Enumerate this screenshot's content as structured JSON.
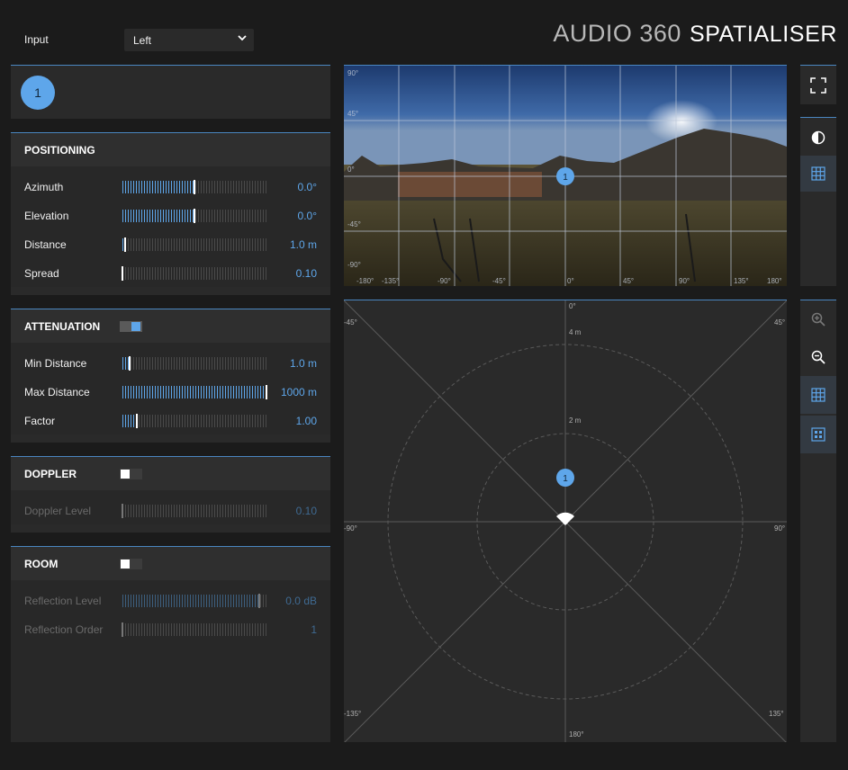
{
  "header": {
    "input_label": "Input",
    "input_value": "Left",
    "logo_audio": "AUDIO 360",
    "logo_spatialiser": "SPATIALISER"
  },
  "source_panel": {
    "selected_source": "1"
  },
  "positioning": {
    "title": "POSITIONING",
    "rows": [
      {
        "label": "Azimuth",
        "value": "0.0°",
        "level": 0.5
      },
      {
        "label": "Elevation",
        "value": "0.0°",
        "level": 0.5
      },
      {
        "label": "Distance",
        "value": "1.0 m",
        "level": 0.02
      },
      {
        "label": "Spread",
        "value": "0.10",
        "level": 0.0
      }
    ]
  },
  "attenuation": {
    "title": "ATTENUATION",
    "enabled": true,
    "rows": [
      {
        "label": "Min Distance",
        "value": "1.0 m",
        "level": 0.05
      },
      {
        "label": "Max Distance",
        "value": "1000 m",
        "level": 1.0
      },
      {
        "label": "Factor",
        "value": "1.00",
        "level": 0.1
      }
    ]
  },
  "doppler": {
    "title": "DOPPLER",
    "enabled": false,
    "rows": [
      {
        "label": "Doppler Level",
        "value": "0.10",
        "level": 0.0
      }
    ]
  },
  "room": {
    "title": "ROOM",
    "enabled": false,
    "rows": [
      {
        "label": "Reflection Level",
        "value": "0.0 dB",
        "level": 0.95
      },
      {
        "label": "Reflection Order",
        "value": "1",
        "level": 0.0
      }
    ]
  },
  "panorama": {
    "elevation_labels": [
      "90°",
      "45°",
      "0°",
      "-45°",
      "-90°"
    ],
    "azimuth_labels": [
      "-180°",
      "-135°",
      "-90°",
      "-45°",
      "0°",
      "45°",
      "90°",
      "135°",
      "180°"
    ],
    "source_label": "1"
  },
  "top_down": {
    "angle_labels": {
      "top": "0°",
      "top_left": "-45°",
      "top_right": "45°",
      "left": "-90°",
      "right": "90°",
      "bottom_left": "-135°",
      "bottom_right": "135°",
      "bottom": "180°"
    },
    "ring_labels": [
      "4 m",
      "2 m"
    ],
    "source_label": "1"
  },
  "toolbar_top": [
    "fullscreen-icon",
    "contrast-icon",
    "grid-icon"
  ],
  "toolbar_bottom": [
    "zoom-in-icon",
    "zoom-out-icon",
    "grid-icon",
    "dots-icon"
  ],
  "colors": {
    "accent": "#5ea6ea",
    "panel": "#2a2a2a",
    "background": "#1b1b1b"
  }
}
